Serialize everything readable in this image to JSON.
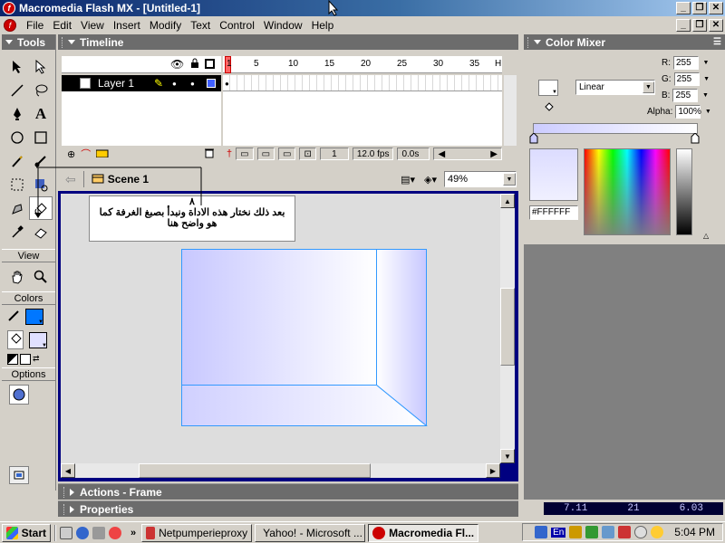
{
  "window": {
    "title": "Macromedia Flash MX - [Untitled-1]",
    "buttons": [
      "_",
      "❐",
      "✕"
    ]
  },
  "menu": {
    "items": [
      "File",
      "Edit",
      "View",
      "Insert",
      "Modify",
      "Text",
      "Control",
      "Window",
      "Help"
    ]
  },
  "tools": {
    "title": "Tools",
    "view_label": "View",
    "colors_label": "Colors",
    "options_label": "Options",
    "stroke_color": "#0077ff",
    "fill_color": "#e0e0ff"
  },
  "timeline": {
    "title": "Timeline",
    "layer_name": "Layer 1",
    "frame_numbers": [
      "1",
      "5",
      "10",
      "15",
      "20",
      "25",
      "30",
      "35"
    ],
    "current_frame": "1",
    "fps": "12.0 fps",
    "elapsed": "0.0s",
    "ruler_end": "H"
  },
  "scene": {
    "name": "Scene 1",
    "zoom": "49%"
  },
  "callout": {
    "number": "٨",
    "text": "بعد ذلك نختار هذه الاداة ونبدأ بصبغ الغرفة كما هو واضح هنا"
  },
  "panels": {
    "actions": "Actions - Frame",
    "properties": "Properties"
  },
  "mixer": {
    "title": "Color Mixer",
    "r_label": "R:",
    "g_label": "G:",
    "b_label": "B:",
    "alpha_label": "Alpha:",
    "r": "255",
    "g": "255",
    "b": "255",
    "alpha": "100%",
    "fill_type": "Linear",
    "hex": "#FFFFFF"
  },
  "taskbar": {
    "start": "Start",
    "tasks": [
      "Netpumperieproxy",
      "Yahoo! - Microsoft ...",
      "Macromedia Fl..."
    ],
    "lang": "En",
    "time": "5:04 PM",
    "media_readout": [
      "7.11",
      "21",
      "6.03"
    ]
  }
}
